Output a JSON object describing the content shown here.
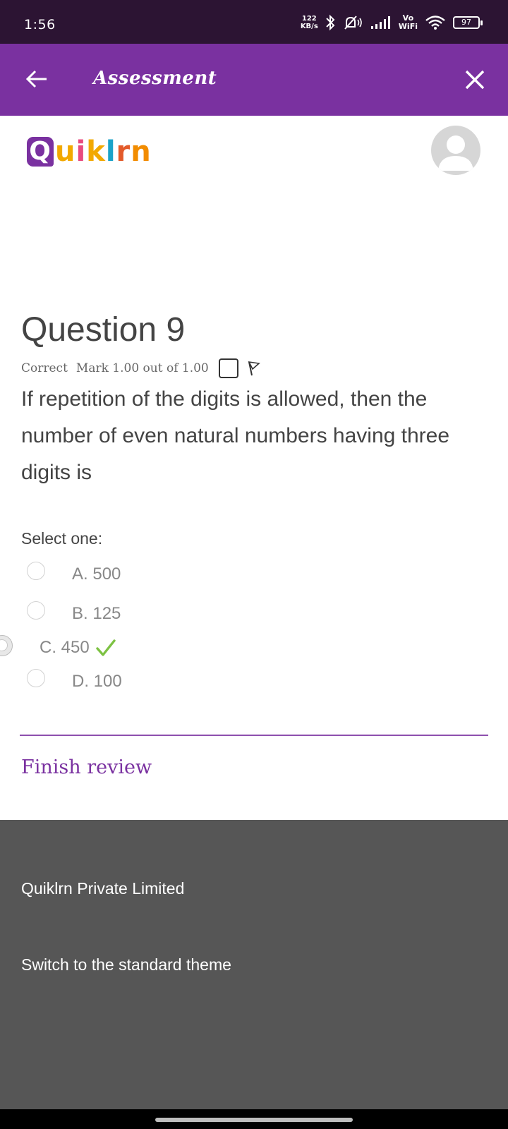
{
  "status_bar": {
    "time": "1:56",
    "net_speed_value": "122",
    "net_speed_unit": "KB/s",
    "vowifi_top": "Vo",
    "vowifi_bottom": "WiFi",
    "battery_level": "97"
  },
  "app_bar": {
    "title": "Assessment",
    "back_icon": "arrow-left-icon",
    "close_icon": "close-icon"
  },
  "brand": {
    "logo_initial": "Q",
    "logo_letters": [
      "u",
      "i",
      "k",
      "l",
      "r",
      "n"
    ],
    "logo_colors": [
      "#7a31a0",
      "#f2a900",
      "#e84a7f",
      "#f2a900",
      "#1aa3c9",
      "#e35a2a",
      "#f28c00"
    ]
  },
  "question": {
    "title": "Question 9",
    "status": "Correct",
    "mark": "Mark 1.00 out of 1.00",
    "text": "If repetition of the digits is allowed, then the number of even natural numbers having three digits is",
    "select_label": "Select one:",
    "options": [
      {
        "label": "A. 500",
        "selected": false
      },
      {
        "label": "B. 125",
        "selected": false
      },
      {
        "label": "C. 450",
        "selected": true,
        "correct": true
      },
      {
        "label": "D. 100",
        "selected": false
      }
    ]
  },
  "actions": {
    "finish_review": "Finish review"
  },
  "footer": {
    "company": "Quiklrn Private Limited",
    "switch_theme": "Switch to the standard theme"
  },
  "colors": {
    "accent": "#7a31a0",
    "status_bar": "#2c1433",
    "footer_bg": "#565656",
    "correct_check": "#7dc243"
  }
}
